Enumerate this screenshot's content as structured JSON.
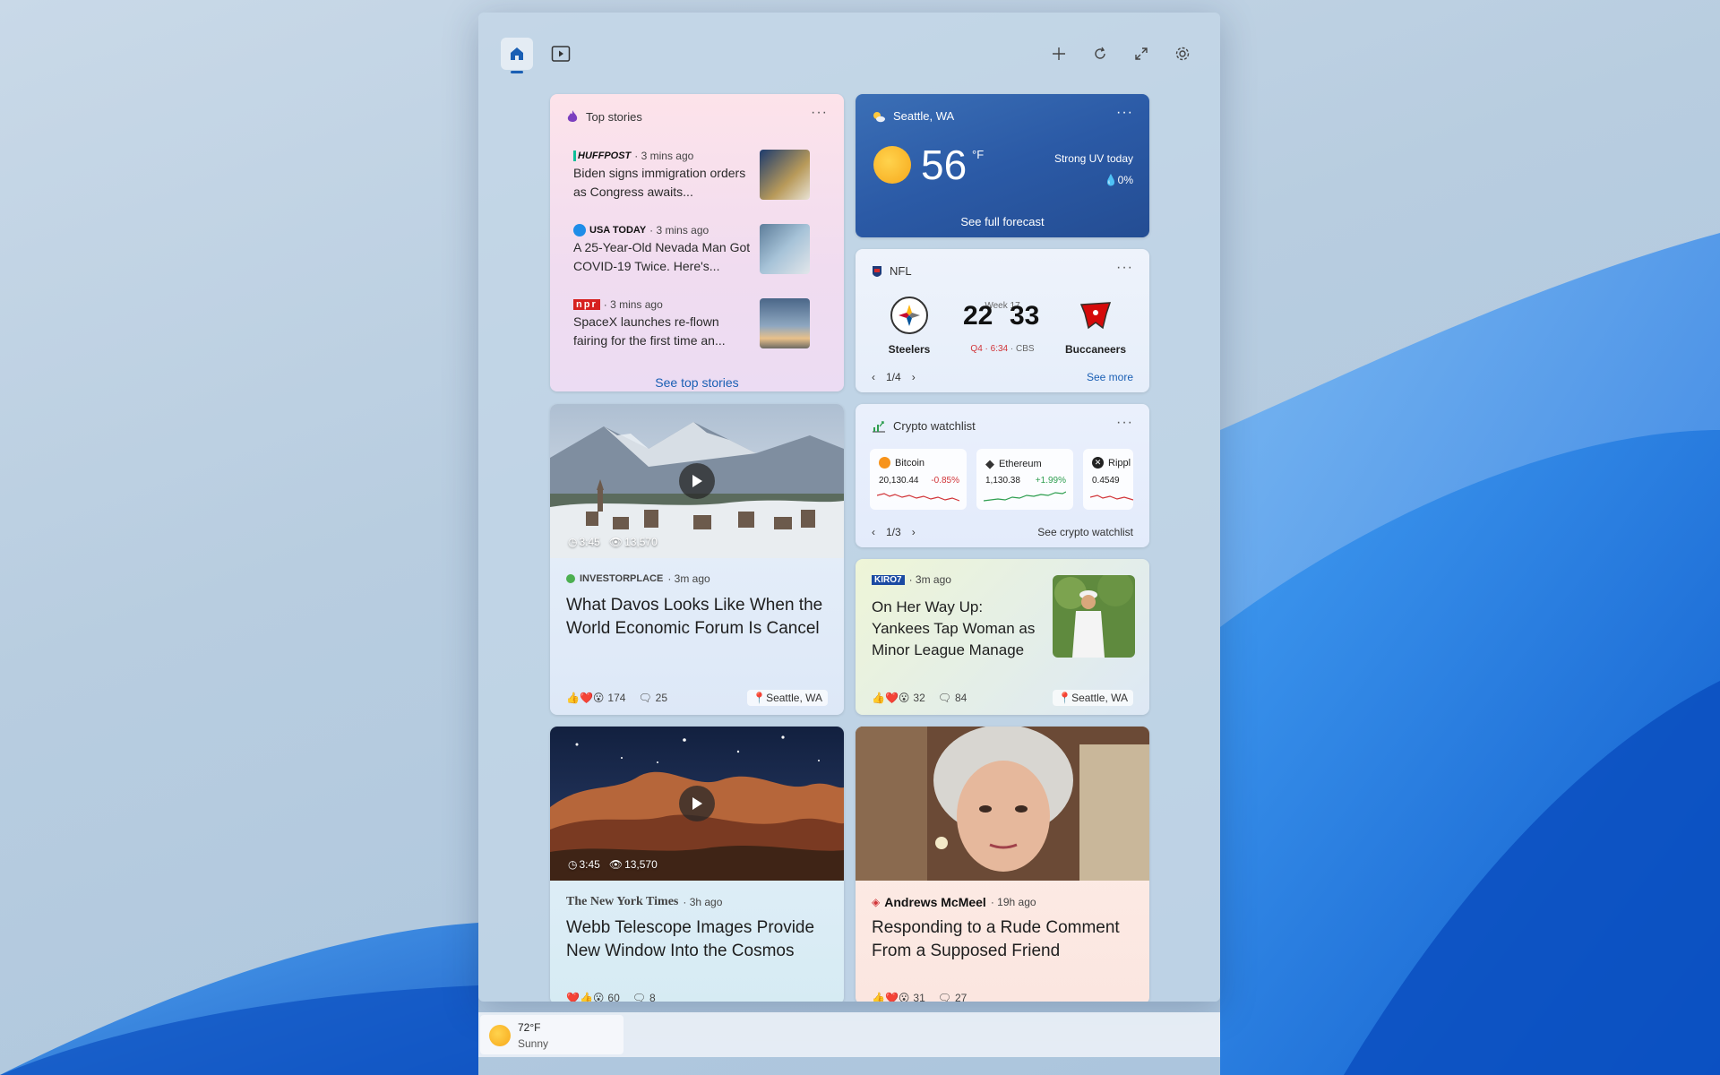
{
  "toolbar": {
    "home_icon": "home-icon",
    "video_icon": "play-icon",
    "actions": [
      "add-icon",
      "refresh-icon",
      "expand-icon",
      "settings-icon"
    ]
  },
  "top_stories": {
    "title": "Top stories",
    "more": "···",
    "stories": [
      {
        "source": "HUFFPOST",
        "time": "· 3 mins ago",
        "headline": "Biden signs immigration orders as Congress awaits..."
      },
      {
        "source": "USA TODAY",
        "time": "· 3 mins ago",
        "headline": "A 25-Year-Old Nevada Man Got COVID-19 Twice. Here's..."
      },
      {
        "source": "npr",
        "time": "· 3 mins ago",
        "headline": "SpaceX launches re-flown fairing for the first time an..."
      }
    ],
    "see_link": "See top stories"
  },
  "weather": {
    "location": "Seattle, WA",
    "more": "···",
    "temp": "56",
    "unit": "°F",
    "uv": "Strong UV today",
    "precip": "💧0%",
    "forecast": "See full forecast"
  },
  "nfl": {
    "title": "NFL",
    "more": "···",
    "week": "Week 17",
    "home_team": "Steelers",
    "away_team": "Buccaneers",
    "home_score": "22",
    "away_score": "33",
    "status_quarter": "Q4 · 6:34",
    "status_network": " · CBS",
    "pager": "1/4",
    "see_more": "See more"
  },
  "crypto": {
    "title": "Crypto watchlist",
    "more": "···",
    "coins": [
      {
        "name": "Bitcoin",
        "price": "20,130.44",
        "change": "-0.85%",
        "color": "#d13438"
      },
      {
        "name": "Ethereum",
        "price": "1,130.38",
        "change": "+1.99%",
        "color": "#2e9e4f"
      },
      {
        "name": "Rippl",
        "price": "0.4549",
        "change": "",
        "color": "#d13438"
      }
    ],
    "pager": "1/3",
    "see_link": "See crypto watchlist"
  },
  "davos": {
    "duration": "3:45",
    "views": "13,570",
    "source": "INVESTORPLACE",
    "time": "· 3m ago",
    "headline": "What Davos Looks Like When the World Economic Forum Is Cancel",
    "reactions": "174",
    "comments": "25",
    "location": "Seattle, WA"
  },
  "yankees": {
    "source": "KIRO7",
    "time": "· 3m ago",
    "headline": "On Her Way Up: Yankees Tap Woman as Minor League Manage",
    "reactions": "32",
    "comments": "84",
    "location": "Seattle, WA"
  },
  "webb": {
    "duration": "3:45",
    "views": "13,570",
    "source": "The New York Times",
    "time": "· 3h ago",
    "headline": "Webb Telescope Images Provide New Window Into the Cosmos",
    "reactions": "60",
    "comments": "8"
  },
  "rude": {
    "source": "Andrews McMeel",
    "time": "· 19h ago",
    "headline": "Responding to a Rude Comment From a Supposed Friend",
    "reactions": "31",
    "comments": "27"
  },
  "taskbar": {
    "temp": "72°F",
    "condition": "Sunny"
  }
}
